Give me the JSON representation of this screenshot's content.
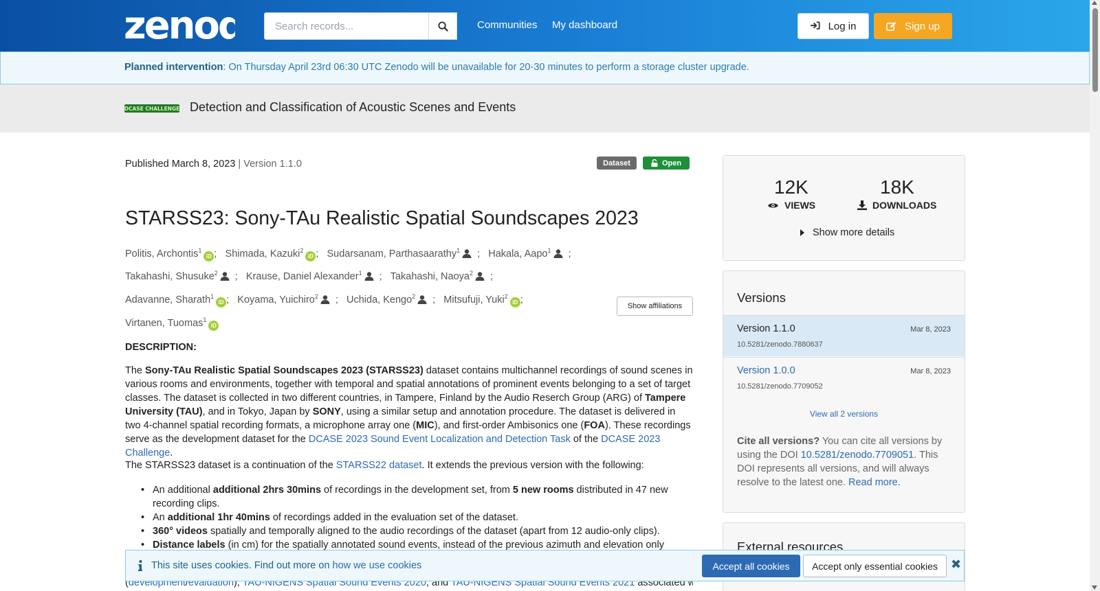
{
  "header": {
    "logo_text": "zenodo",
    "search_placeholder": "Search records...",
    "nav": [
      "Communities",
      "My dashboard"
    ],
    "login_label": "Log in",
    "signup_label": "Sign up",
    "brand_color": "#0a4fa3",
    "signup_color": "#f5a623"
  },
  "banner": {
    "strong": "Planned intervention",
    "text": ": On Thursday April 23rd 06:30 UTC Zenodo will be unavailable for 20-30 minutes to perform a storage cluster upgrade."
  },
  "community": {
    "logo_text": "DCASE CHALLENGE",
    "title": "Detection and Classification of Acoustic Scenes and Events"
  },
  "record": {
    "published": "Published March 8, 2023",
    "separator": " | ",
    "version": "Version 1.1.0",
    "badge_type": "Dataset",
    "badge_access": "Open",
    "title": "STARSS23: Sony-TAu Realistic Spatial Soundscapes 2023",
    "authors": [
      {
        "name": "Politis, Archontis",
        "aff": "1",
        "icon": "orcid"
      },
      {
        "name": "Shimada, Kazuki",
        "aff": "2",
        "icon": "orcid"
      },
      {
        "name": "Sudarsanam, Parthasaarathy",
        "aff": "1",
        "icon": "person"
      },
      {
        "name": "Hakala, Aapo",
        "aff": "1",
        "icon": "person"
      },
      {
        "name": "Takahashi, Shusuke",
        "aff": "2",
        "icon": "person"
      },
      {
        "name": "Krause, Daniel Alexander",
        "aff": "1",
        "icon": "person"
      },
      {
        "name": "Takahashi, Naoya",
        "aff": "2",
        "icon": "person"
      },
      {
        "name": "Adavanne, Sharath",
        "aff": "1",
        "icon": "orcid"
      },
      {
        "name": "Koyama, Yuichiro",
        "aff": "2",
        "icon": "person"
      },
      {
        "name": "Uchida, Kengo",
        "aff": "2",
        "icon": "person"
      },
      {
        "name": "Mitsufuji, Yuki",
        "aff": "2",
        "icon": "orcid"
      },
      {
        "name": "Virtanen, Tuomas",
        "aff": "1",
        "icon": "orcid"
      }
    ],
    "author_separator": ";",
    "orcid_label": "iD",
    "show_affiliations": "Show affiliations"
  },
  "description": {
    "heading": "DESCRIPTION:",
    "p1": [
      {
        "t": "The "
      },
      {
        "t": "Sony-TAu Realistic Spatial Soundscapes 2023 (STARSS23)",
        "b": true
      },
      {
        "t": " dataset contains multichannel recordings of sound scenes in various rooms and environments, together with temporal and spatial annotations of prominent events belonging to a set of target classes. The dataset is collected in two different countries, in Tampere, Finland by the Audio Reserch Group (ARG) of "
      },
      {
        "t": "Tampere University (TAU)",
        "b": true
      },
      {
        "t": ", and in Tokyo, Japan by "
      },
      {
        "t": "SONY",
        "b": true
      },
      {
        "t": ", using a similar setup and annotation procedure. The dataset is delivered in two 4-channel spatial recording formats, a microphone array one ("
      },
      {
        "t": "MIC",
        "b": true
      },
      {
        "t": "), and first-order Ambisonics one ("
      },
      {
        "t": "FOA",
        "b": true
      },
      {
        "t": "). These recordings serve as the development dataset for the "
      },
      {
        "t": "DCASE 2023 Sound Event Localization and Detection Task",
        "link": true
      },
      {
        "t": " of the "
      },
      {
        "t": "DCASE 2023 Challenge",
        "link": true
      },
      {
        "t": "."
      }
    ],
    "p2": [
      {
        "t": "The STARSS23 dataset is a continuation of the "
      },
      {
        "t": "STARSS22 dataset",
        "link": true
      },
      {
        "t": ". It extends the previous version with the following:"
      }
    ],
    "bullets": [
      [
        {
          "t": "An additional "
        },
        {
          "t": "additional 2hrs 30mins",
          "b": true
        },
        {
          "t": " of recordings in the development set, from "
        },
        {
          "t": "5 new rooms",
          "b": true
        },
        {
          "t": " distributed in 47 new recording clips."
        }
      ],
      [
        {
          "t": "An "
        },
        {
          "t": "additional 1hr 40mins",
          "b": true
        },
        {
          "t": " of recordings added in the evaluation set of the dataset."
        }
      ],
      [
        {
          "t": "360° videos",
          "b": true
        },
        {
          "t": " spatially and temporally aligned to the audio recordings of the dataset (apart from 12 audio-only clips)."
        }
      ],
      [
        {
          "t": "Distance labels",
          "b": true
        },
        {
          "t": " (in cm) for the spatially annotated sound events, instead of the previous azimuth and elevation only labels."
        }
      ]
    ],
    "cut_line": [
      {
        "t": "("
      },
      {
        "t": "development",
        "link": true
      },
      {
        "t": "/"
      },
      {
        "t": "evaluation",
        "link": true
      },
      {
        "t": "), "
      },
      {
        "t": "TAU-NIGENS Spatial Sound Events 2020",
        "link": true
      },
      {
        "t": ", and "
      },
      {
        "t": "TAU-NIGENS Spatial Sound Events 2021",
        "link": true
      },
      {
        "t": " associated with"
      }
    ]
  },
  "stats": {
    "views_num": "12K",
    "views_label": "VIEWS",
    "downloads_num": "18K",
    "downloads_label": "DOWNLOADS",
    "show_more": "Show more details"
  },
  "versions": {
    "heading": "Versions",
    "items": [
      {
        "label": "Version 1.1.0",
        "date": "Mar 8, 2023",
        "doi": "10.5281/zenodo.7880637",
        "active": true
      },
      {
        "label": "Version 1.0.0",
        "date": "Mar 8, 2023",
        "doi": "10.5281/zenodo.7709052",
        "active": false
      }
    ],
    "view_all": "View all 2 versions",
    "cite_strong": "Cite all versions?",
    "cite_pre": " You can cite all versions by using the DOI ",
    "cite_doi": "10.5281/zenodo.7709051",
    "cite_post": ". This DOI represents all versions, and will always resolve to the latest one. ",
    "read_more": "Read more."
  },
  "external": {
    "heading": "External resources"
  },
  "cookies": {
    "text": "This site uses cookies. Find out more on ",
    "link": "how we use cookies",
    "accept_all": "Accept all cookies",
    "accept_essential": "Accept only essential cookies",
    "close": "✖"
  }
}
